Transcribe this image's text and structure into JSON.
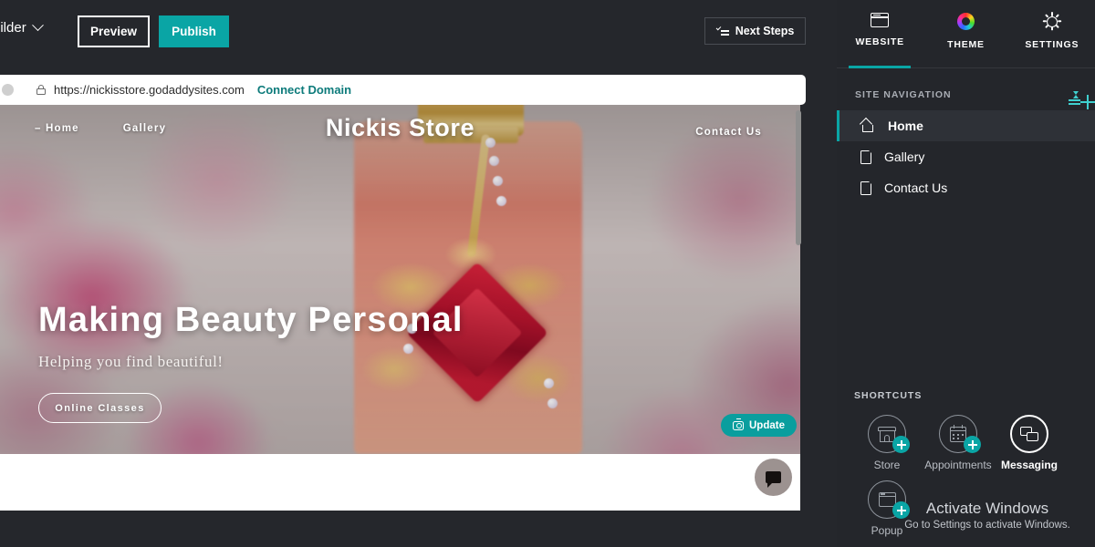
{
  "topbar": {
    "builder_label": "uilder",
    "preview_label": "Preview",
    "publish_label": "Publish",
    "next_steps_label": "Next Steps"
  },
  "urlbar": {
    "url": "https://nickisstore.godaddysites.com",
    "connect_domain_label": "Connect Domain"
  },
  "site": {
    "title": "Nickis Store",
    "nav": [
      {
        "label": "Home",
        "active": true
      },
      {
        "label": "Gallery",
        "active": false
      }
    ],
    "nav_right": "Contact Us",
    "hero": {
      "heading": "Making Beauty Personal",
      "subheading": "Helping you find beautiful!",
      "cta_label": "Online Classes"
    },
    "update_label": "Update"
  },
  "panel": {
    "tabs": [
      {
        "label": "WEBSITE",
        "icon": "browser-icon",
        "active": true
      },
      {
        "label": "THEME",
        "icon": "colorwheel-icon",
        "active": false
      },
      {
        "label": "SETTINGS",
        "icon": "gear-icon",
        "active": false
      }
    ],
    "site_navigation": {
      "header": "SITE NAVIGATION",
      "items": [
        {
          "label": "Home",
          "icon": "home-icon",
          "active": true
        },
        {
          "label": "Gallery",
          "icon": "doc-icon",
          "active": false
        },
        {
          "label": "Contact Us",
          "icon": "doc-icon",
          "active": false
        }
      ]
    },
    "shortcuts": {
      "header": "SHORTCUTS",
      "items": [
        {
          "label": "Store",
          "icon": "store-icon",
          "bright": false
        },
        {
          "label": "Appointments",
          "icon": "calendar-icon",
          "bright": false
        },
        {
          "label": "Messaging",
          "icon": "messaging-icon",
          "bright": true
        },
        {
          "label": "Popup",
          "icon": "popup-icon",
          "bright": false
        }
      ]
    }
  },
  "watermark": {
    "title": "Activate Windows",
    "subtitle": "Go to Settings to activate Windows."
  },
  "colors": {
    "accent_teal": "#0aa5a5",
    "panel_bg": "#24262b",
    "editor_bg": "#25272c",
    "link_teal": "#0d7b7b"
  }
}
